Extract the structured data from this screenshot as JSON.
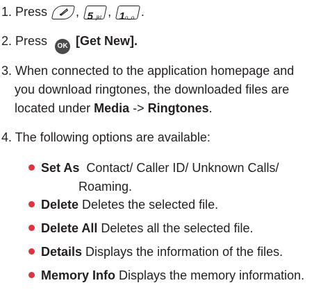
{
  "steps": [
    {
      "prefix": "1. Press",
      "key5": "5",
      "key5_sub": "jkl",
      "key1": "1",
      "key1_sub": "o_o",
      "sep": ",",
      "end": "."
    },
    {
      "prefix": "2. Press",
      "ok": "OK",
      "label": "[Get New]."
    },
    {
      "line1": "3. When connected to the application homepage and",
      "line2a": "you download ringtones, the downloaded files are",
      "line3a": "located under ",
      "media": "Media",
      "arrow": " -> ",
      "ringtones": "Ringtones",
      "dot": "."
    },
    {
      "text": "4. The following options are available:"
    }
  ],
  "options": [
    {
      "name": "Set As",
      "desc": "Contact/ Caller ID/ Unknown Calls/",
      "desc2": "Roaming."
    },
    {
      "name": "Delete",
      "desc": "Deletes the selected file."
    },
    {
      "name": "Delete All",
      "desc": "Deletes all the selected file."
    },
    {
      "name": "Details",
      "desc": "Displays the information of the files."
    },
    {
      "name": "Memory Info",
      "desc": "Displays the memory information."
    }
  ],
  "icons": {
    "soft_key": "left-soft-key-icon",
    "ok": "ok-key-icon"
  },
  "colors": {
    "bullet": "#e0343b",
    "text": "#231f20"
  }
}
